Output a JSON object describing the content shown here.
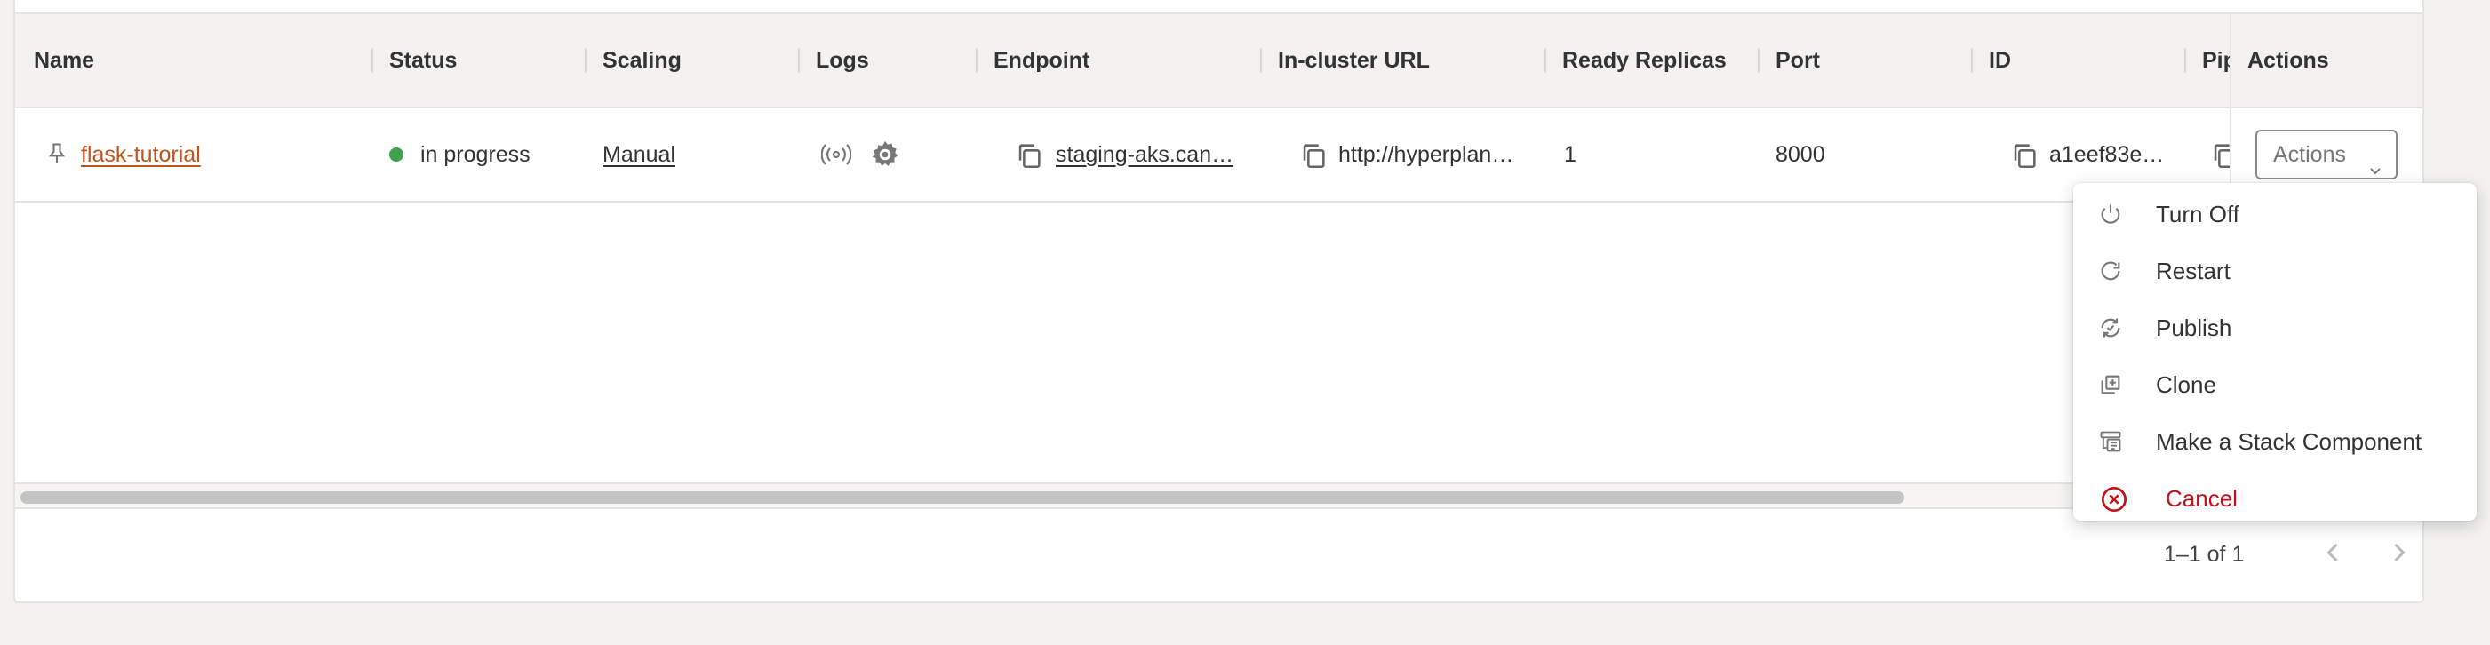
{
  "table": {
    "columns": [
      "Name",
      "Status",
      "Scaling",
      "Logs",
      "Endpoint",
      "In-cluster URL",
      "Ready Replicas",
      "Port",
      "ID",
      "Pip"
    ],
    "actions_column": "Actions",
    "row": {
      "name": "flask-tutorial",
      "status": "in progress",
      "status_color": "#3fa34d",
      "scaling": "Manual",
      "endpoint": "staging-aks.can…",
      "in_cluster_url": "http://hyperplan…",
      "ready_replicas": "1",
      "port": "8000",
      "id": "a1eef83e…",
      "actions_button": "Actions"
    }
  },
  "pagination": {
    "range": "1–1 of 1"
  },
  "menu": {
    "items": [
      {
        "label": "Turn Off",
        "icon": "power-icon"
      },
      {
        "label": "Restart",
        "icon": "restart-icon"
      },
      {
        "label": "Publish",
        "icon": "publish-icon"
      },
      {
        "label": "Clone",
        "icon": "clone-icon"
      },
      {
        "label": "Make a Stack Component",
        "icon": "stack-component-icon"
      },
      {
        "label": "Cancel",
        "icon": "cancel-icon",
        "color": "#c0101a"
      }
    ]
  },
  "colors": {
    "accent": "#c3541c",
    "danger": "#c0101a",
    "background": "#f3f2f0"
  }
}
